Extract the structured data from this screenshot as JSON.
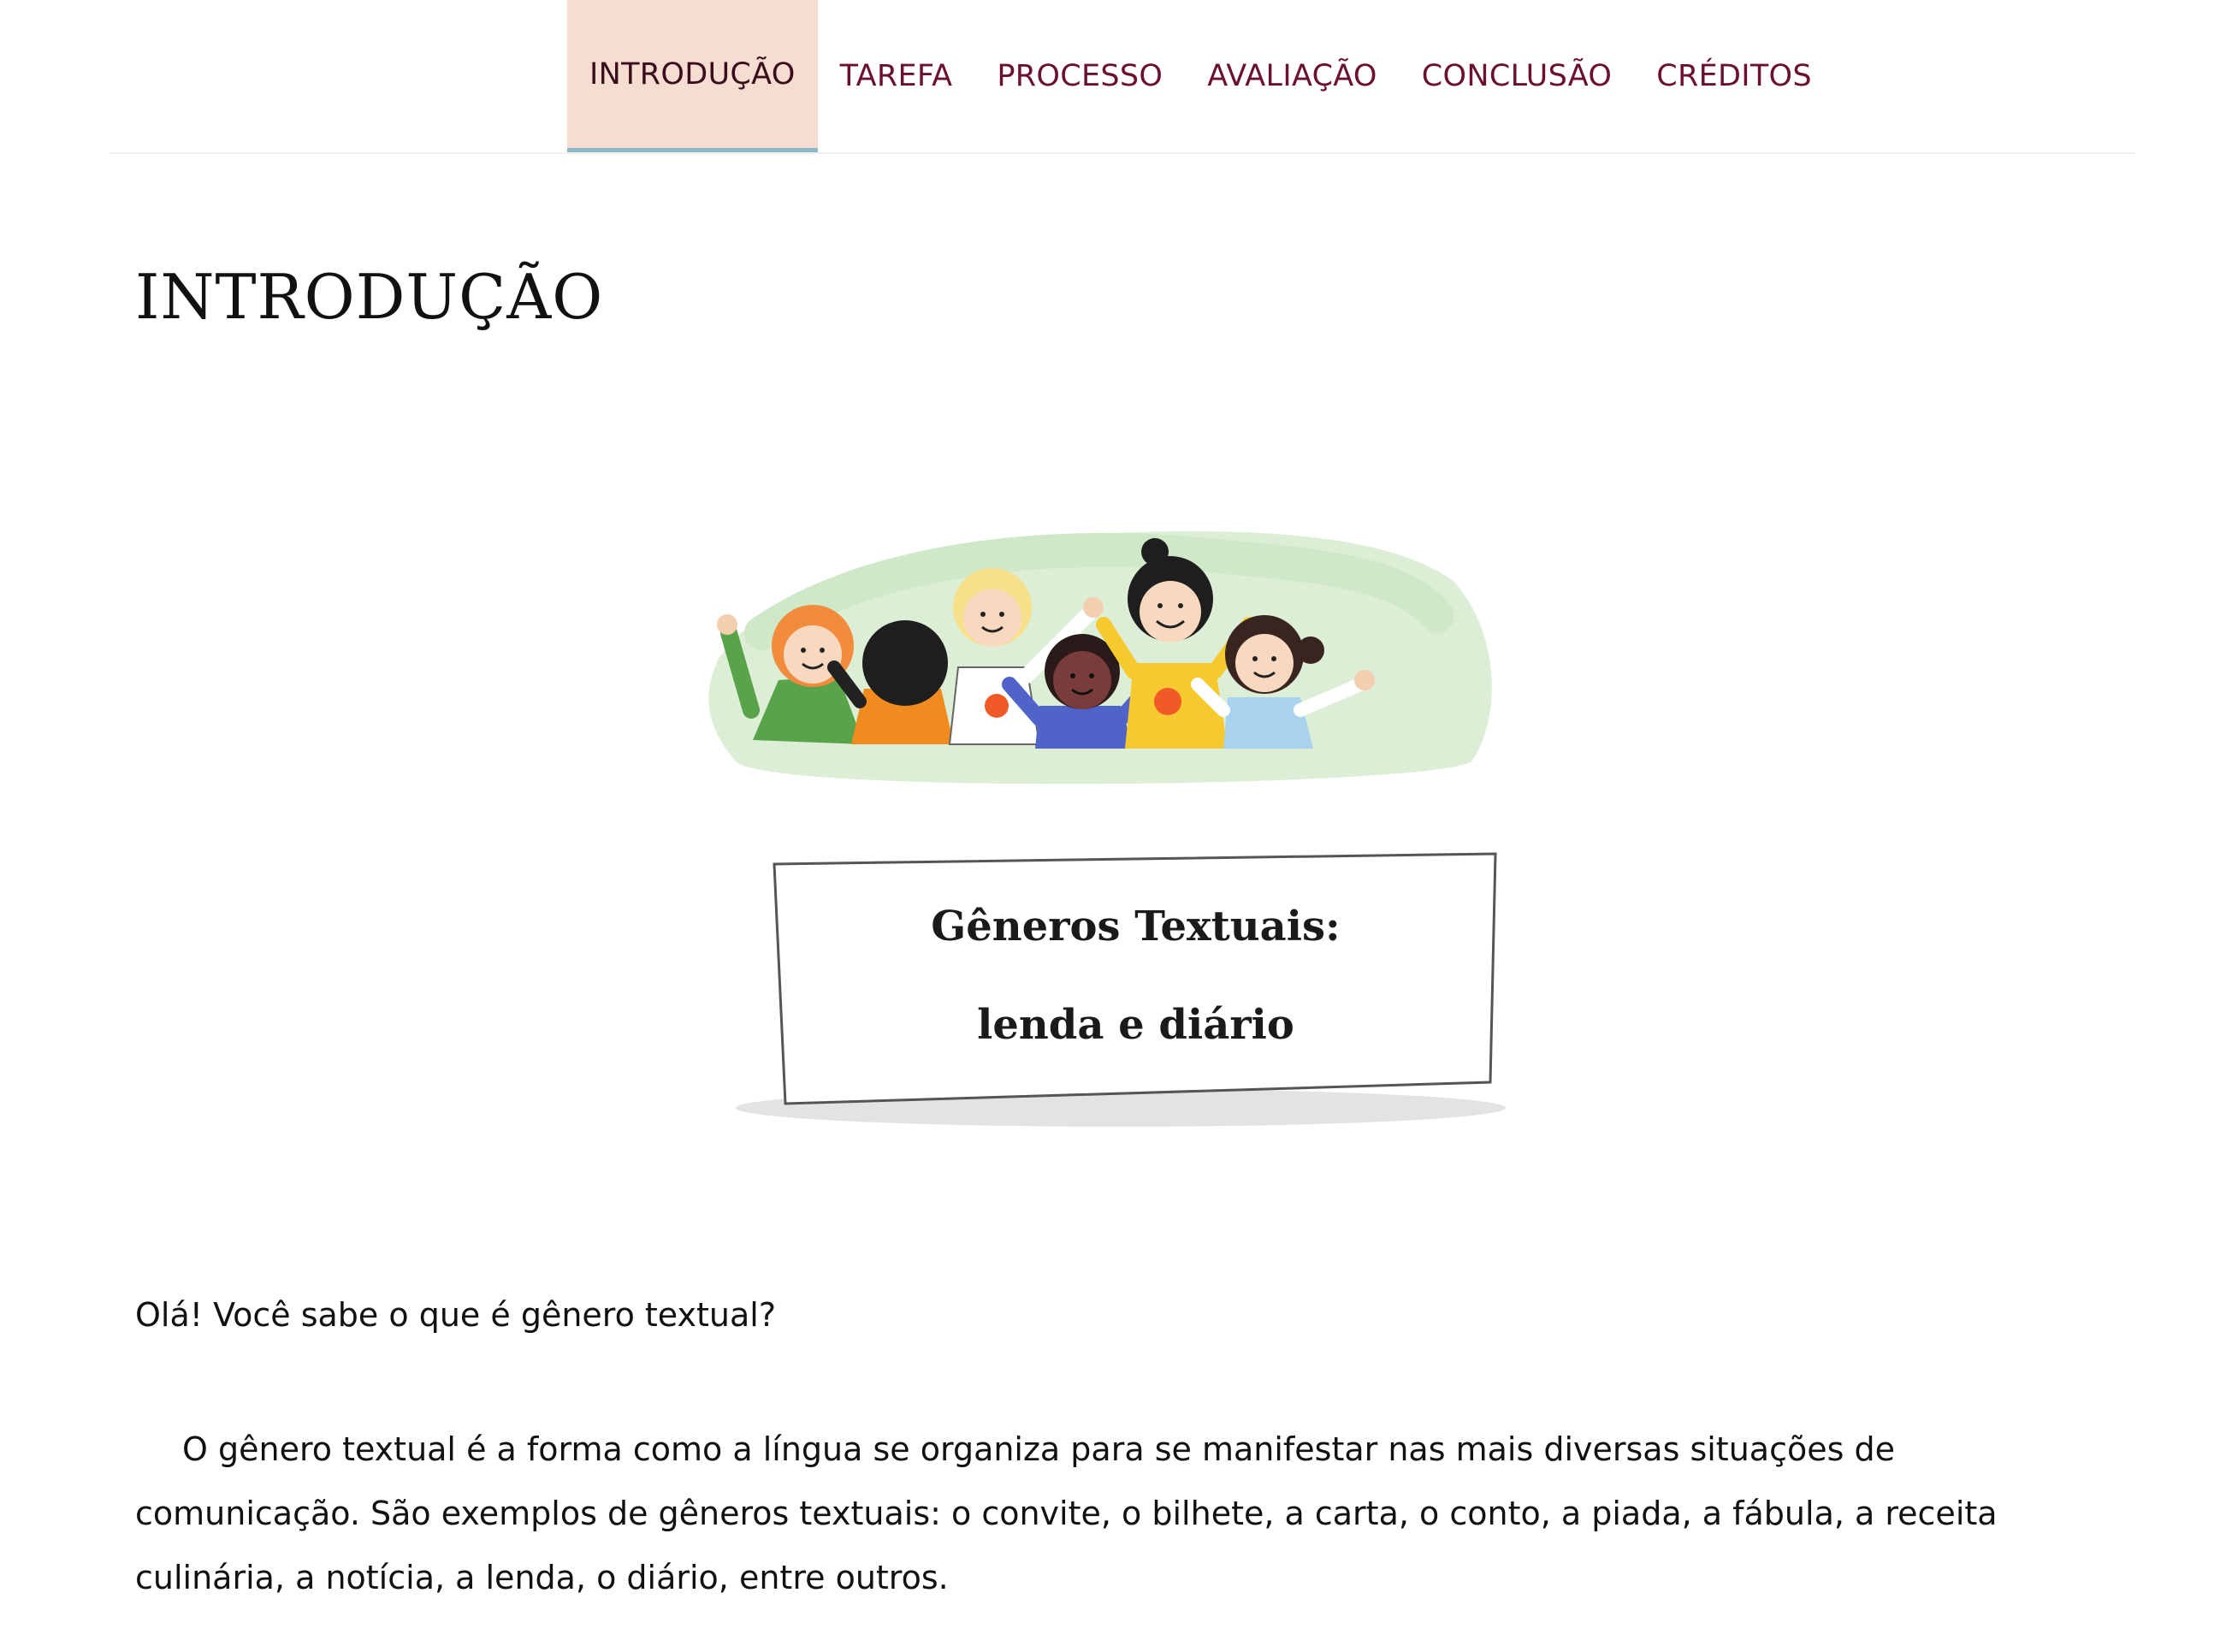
{
  "nav": {
    "items": [
      {
        "label": "INTRODUÇÃO",
        "active": true
      },
      {
        "label": "TAREFA",
        "active": false
      },
      {
        "label": "PROCESSO",
        "active": false
      },
      {
        "label": "AVALIAÇÃO",
        "active": false
      },
      {
        "label": "CONCLUSÃO",
        "active": false
      },
      {
        "label": "CRÉDITOS",
        "active": false
      }
    ]
  },
  "page": {
    "title": "INTRODUÇÃO",
    "question": "Olá! Você sabe o que é gênero textual?",
    "paragraph": "O gênero textual é a forma como a língua se organiza para se manifestar nas mais diversas situações de comunicação. São exemplos de gêneros textuais: o convite, o bilhete, a carta, o conto, a piada, a fábula, a receita culinária, a notícia, a lenda, o diário, entre outros."
  },
  "illustration": {
    "sign_line1": "Gêneros Textuais:",
    "sign_line2": "lenda e diário"
  },
  "colors": {
    "nav_text": "#6b1030",
    "nav_active_bg": "#f6ddd2",
    "nav_active_border": "#8db8c6",
    "illustration_bg": "#dcefd6"
  }
}
